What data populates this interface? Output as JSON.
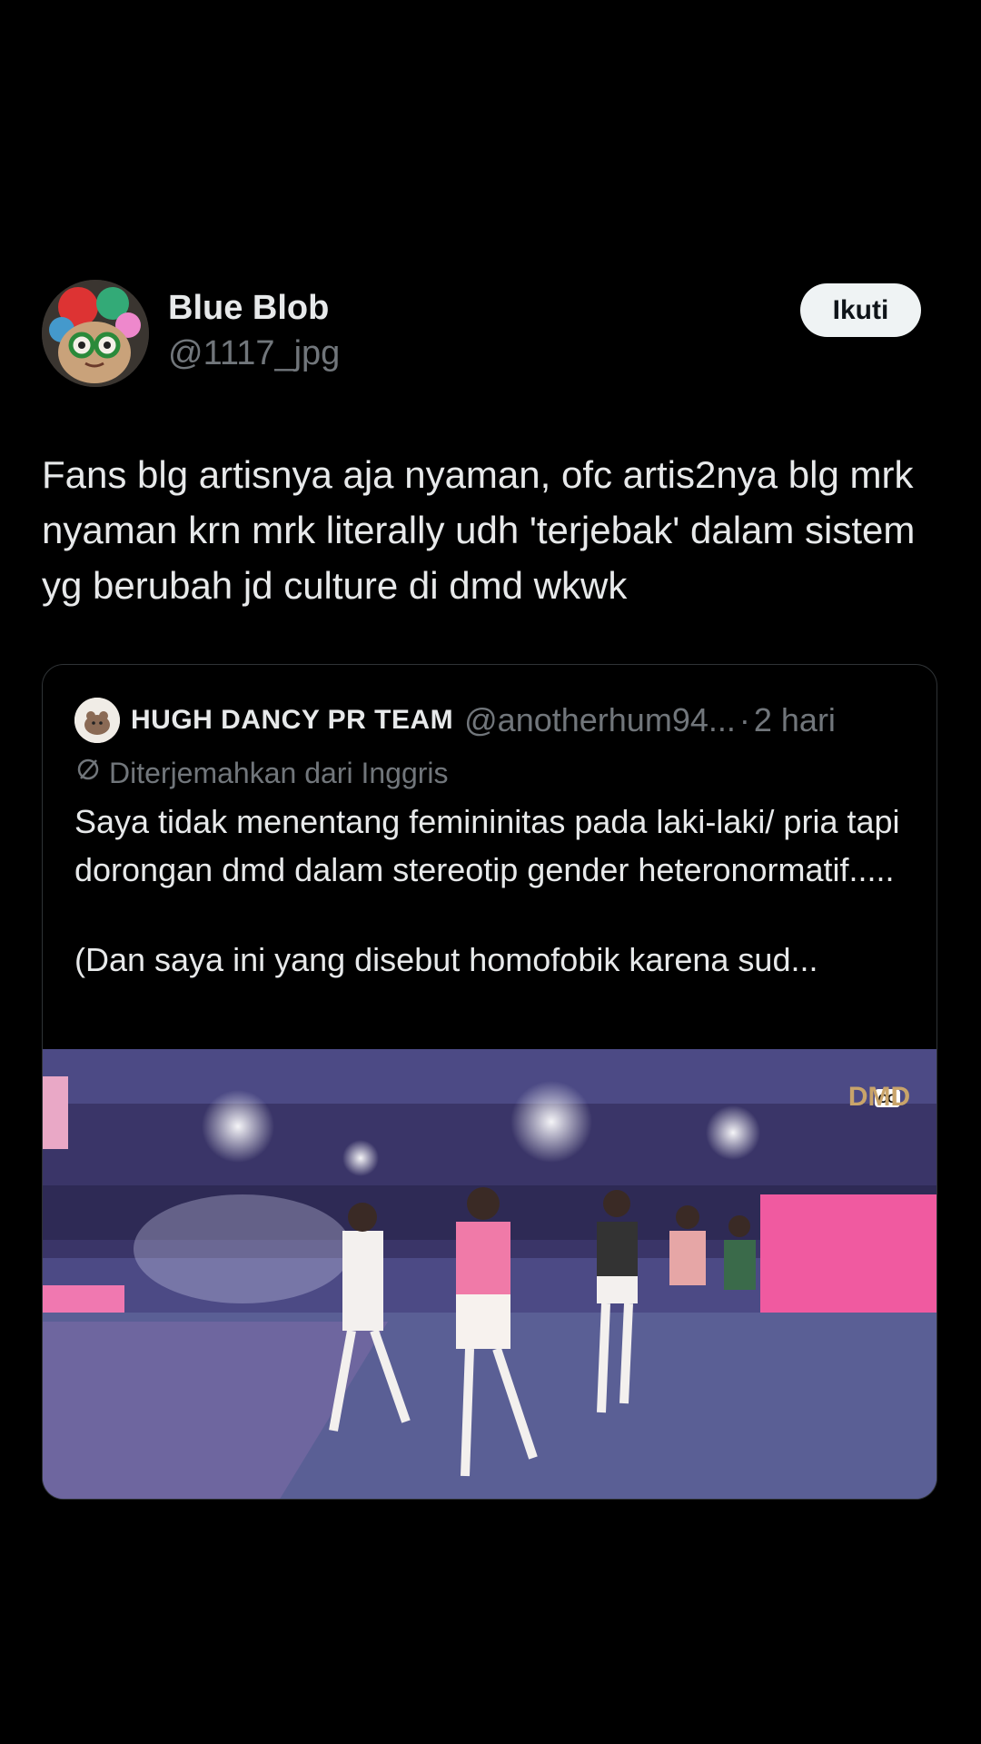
{
  "author": {
    "display_name": "Blue Blob",
    "handle": "@1117_jpg"
  },
  "follow_label": "Ikuti",
  "tweet_text": "Fans blg artisnya aja nyaman, ofc artis2nya blg mrk nyaman krn mrk literally udh 'terjebak' dalam sistem yg berubah jd culture di dmd wkwk",
  "quote": {
    "name": "HUGH DANCY PR TEAM",
    "handle": "@anotherhum94...",
    "separator": "·",
    "time": "2 hari",
    "translated_label": "Diterjemahkan dari Inggris",
    "text_line1": "Saya tidak menentang femininitas pada laki-laki/ pria tapi dorongan dmd dalam stereotip gender heteronormatif.....",
    "text_line2": "(Dan saya ini yang disebut homofobik karena sud...",
    "cc_label": "CC",
    "logo_text": "DMD"
  },
  "icons": {
    "translate": "translate-icon",
    "closed_captions": "cc-icon"
  },
  "colors": {
    "background": "#000000",
    "text_primary": "#e7e9ea",
    "text_secondary": "#71767b",
    "follow_button_bg": "#eff3f4",
    "border": "#2f3336"
  }
}
